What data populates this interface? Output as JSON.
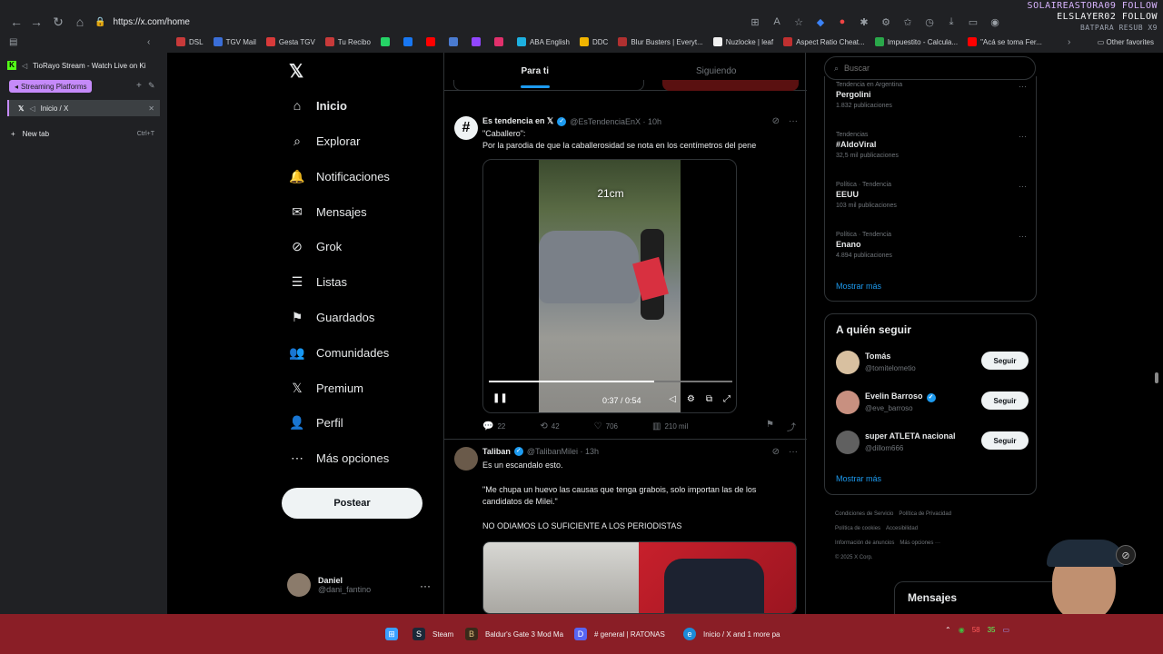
{
  "browser": {
    "url": "https://x.com/home",
    "overlay": {
      "line1": "SOLAIREASTORA09 FOLLOW",
      "line2": "ELSLAYER02 FOLLOW",
      "line3": "BATPARA RESUB X9"
    },
    "bookmarks": [
      {
        "label": "DSL",
        "color": "#c83a3a"
      },
      {
        "label": "TGV Mail",
        "color": "#3a6ed8"
      },
      {
        "label": "Gesta TGV",
        "color": "#d83a3a"
      },
      {
        "label": "Tu Recibo",
        "color": "#c83a3a"
      },
      {
        "label": "",
        "color": "#25d366"
      },
      {
        "label": "",
        "color": "#1877f2"
      },
      {
        "label": "",
        "color": "#ff0000"
      },
      {
        "label": "",
        "color": "#4a7bd0"
      },
      {
        "label": "",
        "color": "#9146ff"
      },
      {
        "label": "",
        "color": "#e1306c"
      },
      {
        "label": "ABA English",
        "color": "#1db0e0"
      },
      {
        "label": "DDC",
        "color": "#f0b400"
      },
      {
        "label": "Blur Busters | Everyt...",
        "color": "#b03030"
      },
      {
        "label": "Nuzlocke | leaf",
        "color": "#f0f0f0"
      },
      {
        "label": "Aspect Ratio Cheat...",
        "color": "#c03030"
      },
      {
        "label": "Impuestito - Calcula...",
        "color": "#2aa84a"
      },
      {
        "label": "\"Acá se toma Fer...",
        "color": "#ff0000"
      }
    ],
    "other_favorites": "Other favorites"
  },
  "vtabs": {
    "pinned_stream": "TioRayo Stream - Watch Live on Ki",
    "group_label": "Streaming Platforms",
    "active_tab": "Inicio / X",
    "new_tab": "New tab",
    "new_tab_shortcut": "Ctrl+T"
  },
  "nav": {
    "items": [
      {
        "label": "Inicio",
        "icon": "⌂"
      },
      {
        "label": "Explorar",
        "icon": "⌕"
      },
      {
        "label": "Notificaciones",
        "icon": "🔔"
      },
      {
        "label": "Mensajes",
        "icon": "✉"
      },
      {
        "label": "Grok",
        "icon": "⊘"
      },
      {
        "label": "Listas",
        "icon": "☰"
      },
      {
        "label": "Guardados",
        "icon": "⚑"
      },
      {
        "label": "Comunidades",
        "icon": "👥"
      },
      {
        "label": "Premium",
        "icon": "𝕏"
      },
      {
        "label": "Perfil",
        "icon": "👤"
      },
      {
        "label": "Más opciones",
        "icon": "⋯"
      }
    ],
    "post_label": "Postear",
    "profile_name": "Daniel",
    "profile_handle": "@dani_fantino"
  },
  "feed": {
    "tabs": [
      "Para ti",
      "Siguiendo"
    ],
    "tweet1": {
      "name": "Es tendencia en 𝕏",
      "handle": "@EsTendenciaEnX · 10h",
      "line1": "\"Caballero\":",
      "line2": "Por la parodia de que la caballerosidad se nota en los centímetros del pene",
      "video_caption": "21cm",
      "video_time": "0:37 / 0:54",
      "video_progress": 0.68,
      "replies": "22",
      "reposts": "42",
      "likes": "706",
      "views": "210 mil"
    },
    "tweet2": {
      "name": "Taliban",
      "handle": "@TalibanMilei · 13h",
      "line1": "Es un escandalo esto.",
      "line2": "\"Me chupa un huevo las causas que tenga grabois, solo importan las de los candidatos de Milei.\"",
      "line3": "NO ODIAMOS LO SUFICIENTE A LOS PERIODISTAS"
    }
  },
  "sidebar": {
    "search_placeholder": "Buscar",
    "trends": [
      {
        "category": "Tendencia en Argentina",
        "name": "Pergolini",
        "count": "1.832 publicaciones"
      },
      {
        "category": "Tendencias",
        "name": "#AldoViral",
        "count": "32,5 mil publicaciones"
      },
      {
        "category": "Política · Tendencia",
        "name": "EEUU",
        "count": "103 mil publicaciones"
      },
      {
        "category": "Política · Tendencia",
        "name": "Enano",
        "count": "4.894 publicaciones"
      }
    ],
    "show_more": "Mostrar más",
    "follow_title": "A quién seguir",
    "follow": [
      {
        "name": "Tomás",
        "handle": "@tomitelometio",
        "button": "Seguir",
        "verified": false
      },
      {
        "name": "Evelin Barroso",
        "handle": "@eve_barroso",
        "button": "Seguir",
        "verified": true
      },
      {
        "name": "super ATLETA nacional",
        "handle": "@dillom666",
        "button": "Seguir",
        "verified": false
      }
    ],
    "footer": [
      "Condiciones de Servicio",
      "Política de Privacidad",
      "Política de cookies",
      "Accesibilidad",
      "Información de anuncios",
      "Más opciones ···",
      "© 2025 X Corp."
    ],
    "messages": "Mensajes"
  },
  "taskbar": {
    "items": [
      "Steam",
      "Baldur's Gate 3 Mod Ma",
      "# general | RATONAS",
      "Inicio / X and 1 more pa"
    ],
    "tray": [
      "58",
      "35"
    ]
  }
}
